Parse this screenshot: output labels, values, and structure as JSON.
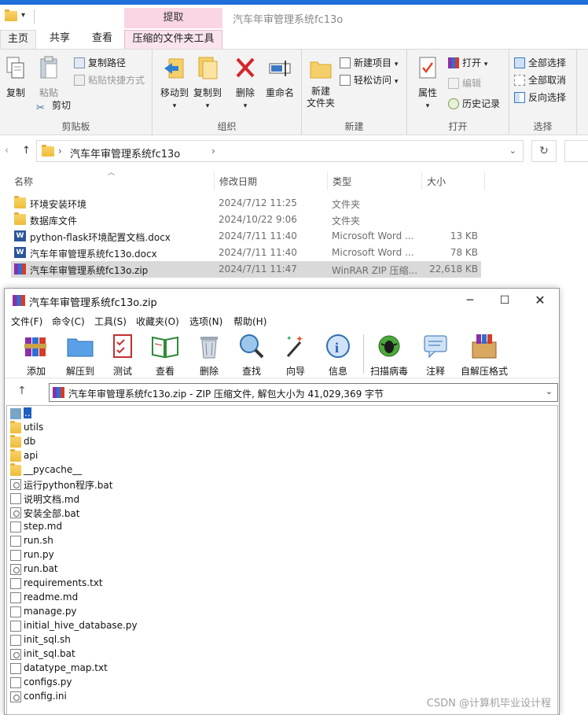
{
  "explorer": {
    "window_title": "汽车年审管理系统fc13o",
    "context_tab_top": "提取",
    "tabs": [
      "主页",
      "共享",
      "查看",
      "压缩的文件夹工具"
    ],
    "ribbon": {
      "clipboard": {
        "label": "剪贴板",
        "copy": "复制",
        "paste": "粘贴",
        "copy_path": "复制路径",
        "paste_shortcut": "粘贴快捷方式",
        "cut": "剪切"
      },
      "organize": {
        "label": "组织",
        "move_to": "移动到",
        "copy_to": "复制到",
        "delete": "删除",
        "rename": "重命名"
      },
      "new": {
        "label": "新建",
        "new_folder": "新建\n文件夹",
        "new_item": "新建项目",
        "easy_access": "轻松访问"
      },
      "open": {
        "label": "打开",
        "properties": "属性",
        "open": "打开",
        "edit": "编辑",
        "history": "历史记录"
      },
      "select": {
        "label": "选择",
        "select_all": "全部选择",
        "select_none": "全部取消",
        "invert": "反向选择"
      }
    },
    "address": {
      "crumb": "汽车年审管理系统fc13o"
    },
    "columns": {
      "name": "名称",
      "date": "修改日期",
      "type": "类型",
      "size": "大小"
    },
    "files": [
      {
        "name": "环境安装环境",
        "date": "2024/7/12 11:25",
        "type": "文件夹",
        "size": "",
        "icon": "folder-icon"
      },
      {
        "name": "数据库文件",
        "date": "2024/10/22 9:06",
        "type": "文件夹",
        "size": "",
        "icon": "folder-icon"
      },
      {
        "name": "python-flask环境配置文档.docx",
        "date": "2024/7/11 11:40",
        "type": "Microsoft Word ...",
        "size": "13 KB",
        "icon": "word-icon"
      },
      {
        "name": "汽车年审管理系统fc13o.docx",
        "date": "2024/7/11 11:40",
        "type": "Microsoft Word ...",
        "size": "78 KB",
        "icon": "word-icon"
      },
      {
        "name": "汽车年审管理系统fc13o.zip",
        "date": "2024/7/11 11:47",
        "type": "WinRAR ZIP 压缩...",
        "size": "22,618 KB",
        "icon": "rar-icon",
        "selected": true
      }
    ]
  },
  "winrar": {
    "title": "汽车年审管理系统fc13o.zip",
    "menu": [
      "文件(F)",
      "命令(C)",
      "工具(S)",
      "收藏夹(O)",
      "选项(N)",
      "帮助(H)"
    ],
    "toolbar": [
      "添加",
      "解压到",
      "测试",
      "查看",
      "删除",
      "查找",
      "向导",
      "信息",
      "扫描病毒",
      "注释",
      "自解压格式"
    ],
    "path": "汽车年审管理系统fc13o.zip - ZIP 压缩文件, 解包大小为 41,029,369 字节",
    "items": [
      {
        "name": "..",
        "icon": "up-folder-icon",
        "selected": true
      },
      {
        "name": "utils",
        "icon": "folder-icon"
      },
      {
        "name": "db",
        "icon": "folder-icon"
      },
      {
        "name": "api",
        "icon": "folder-icon"
      },
      {
        "name": "__pycache__",
        "icon": "folder-icon"
      },
      {
        "name": "运行python程序.bat",
        "icon": "bat-icon"
      },
      {
        "name": "说明文档.md",
        "icon": "file-icon"
      },
      {
        "name": "安装全部.bat",
        "icon": "bat-icon"
      },
      {
        "name": "step.md",
        "icon": "file-icon"
      },
      {
        "name": "run.sh",
        "icon": "file-icon"
      },
      {
        "name": "run.py",
        "icon": "file-icon"
      },
      {
        "name": "run.bat",
        "icon": "bat-icon"
      },
      {
        "name": "requirements.txt",
        "icon": "file-icon"
      },
      {
        "name": "readme.md",
        "icon": "file-icon"
      },
      {
        "name": "manage.py",
        "icon": "file-icon"
      },
      {
        "name": "initial_hive_database.py",
        "icon": "file-icon"
      },
      {
        "name": "init_sql.sh",
        "icon": "file-icon"
      },
      {
        "name": "init_sql.bat",
        "icon": "bat-icon"
      },
      {
        "name": "datatype_map.txt",
        "icon": "file-icon"
      },
      {
        "name": "configs.py",
        "icon": "file-icon"
      },
      {
        "name": "config.ini",
        "icon": "bat-icon"
      }
    ],
    "watermark": "CSDN @计算机毕业设计程"
  },
  "colors": {
    "accent": "#1e6fd8",
    "context_tab": "#f9d5e5",
    "selection": "#d9d9d9",
    "winrar_selection": "#1e5fbf"
  }
}
